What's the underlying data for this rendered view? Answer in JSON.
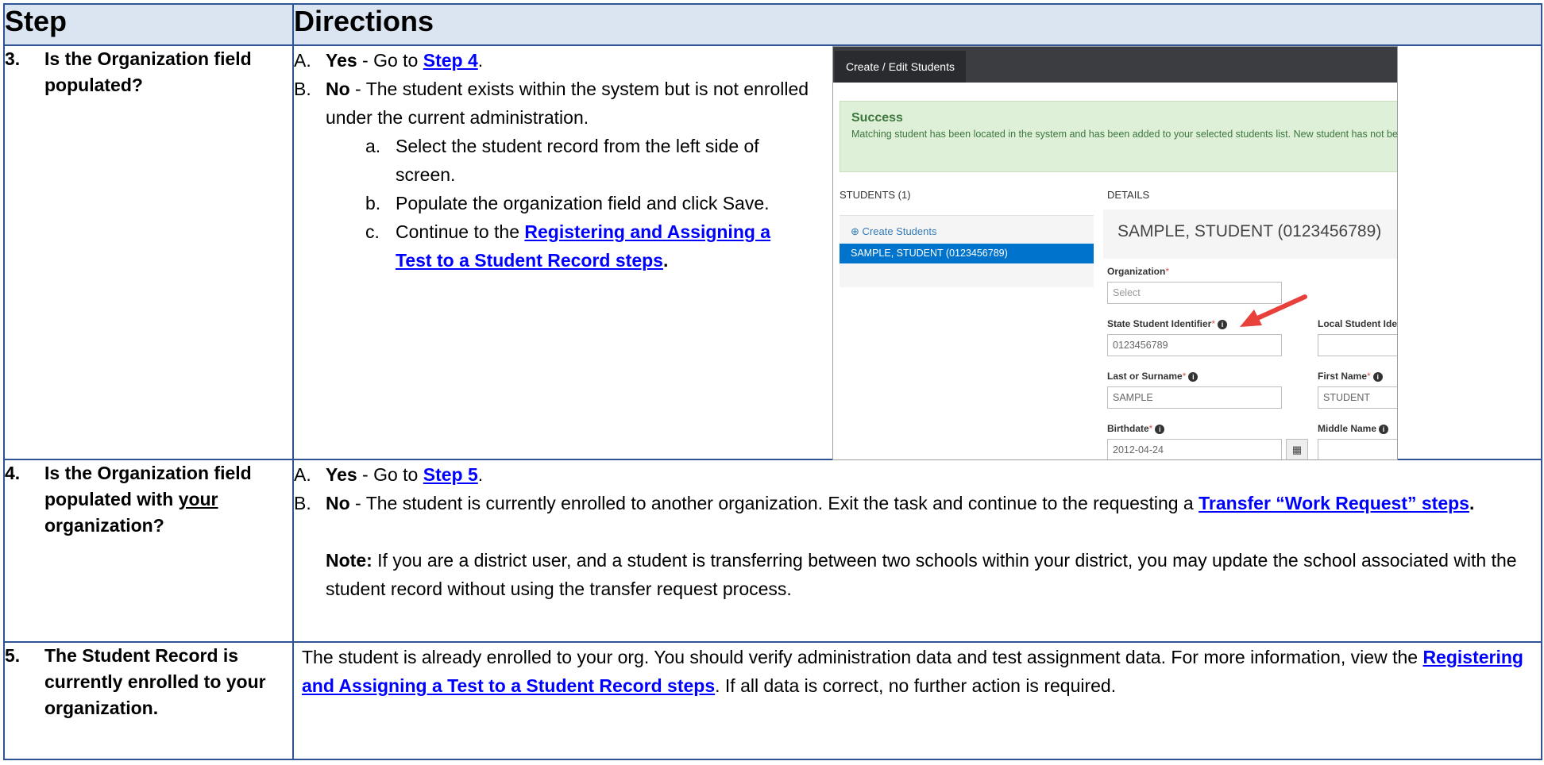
{
  "header": {
    "step": "Step",
    "directions": "Directions"
  },
  "rows": [
    {
      "num": "3.",
      "step": "Is the Organization field populated?",
      "a_marker": "A.",
      "a_bold": "Yes",
      "a_text": " - Go to ",
      "a_link": "Step 4",
      "a_end": ".",
      "b_marker": "B.",
      "b_bold": "No",
      "b_text": " - The student exists within the system but is not enrolled under the current administration.",
      "subitems": [
        {
          "marker": "a.",
          "text": "Select the student record from the left side of screen."
        },
        {
          "marker": "b.",
          "text": "Populate the organization field and click Save."
        }
      ],
      "c_marker": "c.",
      "c_text": "Continue to the ",
      "c_link": "Registering and Assigning a Test to a Student Record steps",
      "c_end": "."
    },
    {
      "num": "4.",
      "step_pre": "Is the Organization field populated with ",
      "step_u": "your",
      "step_post": " organization?",
      "a_marker": "A.",
      "a_bold": "Yes",
      "a_text": " - Go to ",
      "a_link": "Step 5",
      "a_end": ".",
      "b_marker": "B.",
      "b_bold": "No",
      "b_text": " - The student is currently enrolled to another organization. Exit the task and continue to the requesting a ",
      "b_link": "Transfer “Work Request” steps",
      "b_end": ".",
      "note_bold": "Note:",
      "note_text": " If you are a district user, and a student is transferring between two schools within your district, you may update the school associated with the student record without using the transfer request process."
    },
    {
      "num": "5.",
      "step": "The Student Record is currently enrolled to your organization.",
      "text1": "The student is already enrolled to your org. You should verify administration data and test assignment data. For more information, view the ",
      "link": "Registering and Assigning a Test to a Student Record steps",
      "text2": ". If all data is correct, no further action is required."
    }
  ],
  "screenshot": {
    "tab": "Create / Edit Students",
    "success_title": "Success",
    "success_msg": "Matching student has been located in the system and has been added to your selected students list. New student has not been created",
    "students_header": "STUDENTS (1)",
    "details_header": "DETAILS",
    "create_link": "Create Students",
    "student_item": "SAMPLE, STUDENT (0123456789)",
    "detail_name": "SAMPLE, STUDENT (0123456789)",
    "organization_label": "Organization",
    "organization_placeholder": "Select",
    "ssid_label": "State Student Identifier",
    "ssid_value": "0123456789",
    "local_id_label": "Local Student Identifier",
    "local_id_value": "",
    "last_name_label": "Last or Surname",
    "last_name_value": "SAMPLE",
    "first_name_label": "First Name",
    "first_name_value": "STUDENT",
    "birthdate_label": "Birthdate",
    "birthdate_value": "2012-04-24",
    "middle_name_label": "Middle Name",
    "middle_name_value": "",
    "required_mark": "*",
    "info_glyph": "i",
    "calendar_glyph": "▦",
    "arrow_color": "#e8413b"
  }
}
